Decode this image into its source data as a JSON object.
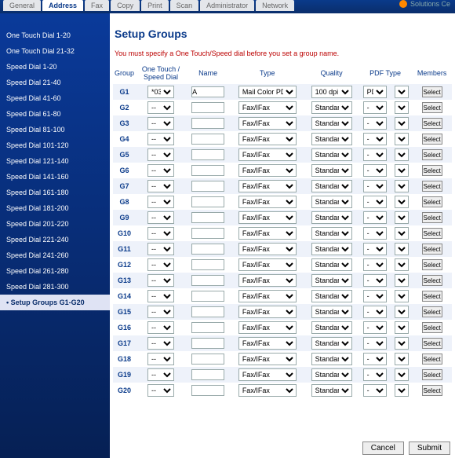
{
  "topTabs": [
    "General",
    "Address",
    "Fax",
    "Copy",
    "Print",
    "Scan",
    "Administrator",
    "Network"
  ],
  "activeTab": 1,
  "brand": "Solutions Ce",
  "sidebar": {
    "items": [
      "One Touch Dial 1-20",
      "One Touch Dial 21-32",
      "Speed Dial 1-20",
      "Speed Dial 21-40",
      "Speed Dial 41-60",
      "Speed Dial 61-80",
      "Speed Dial 81-100",
      "Speed Dial 101-120",
      "Speed Dial 121-140",
      "Speed Dial 141-160",
      "Speed Dial 161-180",
      "Speed Dial 181-200",
      "Speed Dial 201-220",
      "Speed Dial 221-240",
      "Speed Dial 241-260",
      "Speed Dial 261-280",
      "Speed Dial 281-300",
      "Setup Groups G1-G20"
    ],
    "activeIndex": 17
  },
  "page": {
    "title": "Setup Groups",
    "hint": "You must specify a One Touch/Speed dial before you set a group name."
  },
  "headers": {
    "group": "Group",
    "oneTouch": "One Touch /\nSpeed Dial",
    "name": "Name",
    "type": "Type",
    "quality": "Quality",
    "pdfType": "PDF Type",
    "members": "Members"
  },
  "labels": {
    "select": "Select",
    "cancel": "Cancel",
    "submit": "Submit"
  },
  "rows": [
    {
      "g": "G1",
      "ot": "*03",
      "name": "A",
      "type": "Mail Color PDF",
      "quality": "100 dpi",
      "pdft": "PDF",
      "pdft2": "-"
    },
    {
      "g": "G2",
      "ot": "--",
      "name": "",
      "type": "Fax/IFax",
      "quality": "Standard",
      "pdft": "-",
      "pdft2": "-"
    },
    {
      "g": "G3",
      "ot": "--",
      "name": "",
      "type": "Fax/IFax",
      "quality": "Standard",
      "pdft": "-",
      "pdft2": "-"
    },
    {
      "g": "G4",
      "ot": "--",
      "name": "",
      "type": "Fax/IFax",
      "quality": "Standard",
      "pdft": "-",
      "pdft2": "-"
    },
    {
      "g": "G5",
      "ot": "--",
      "name": "",
      "type": "Fax/IFax",
      "quality": "Standard",
      "pdft": "-",
      "pdft2": "-"
    },
    {
      "g": "G6",
      "ot": "--",
      "name": "",
      "type": "Fax/IFax",
      "quality": "Standard",
      "pdft": "-",
      "pdft2": "-"
    },
    {
      "g": "G7",
      "ot": "--",
      "name": "",
      "type": "Fax/IFax",
      "quality": "Standard",
      "pdft": "-",
      "pdft2": "-"
    },
    {
      "g": "G8",
      "ot": "--",
      "name": "",
      "type": "Fax/IFax",
      "quality": "Standard",
      "pdft": "-",
      "pdft2": "-"
    },
    {
      "g": "G9",
      "ot": "--",
      "name": "",
      "type": "Fax/IFax",
      "quality": "Standard",
      "pdft": "-",
      "pdft2": "-"
    },
    {
      "g": "G10",
      "ot": "--",
      "name": "",
      "type": "Fax/IFax",
      "quality": "Standard",
      "pdft": "-",
      "pdft2": "-"
    },
    {
      "g": "G11",
      "ot": "--",
      "name": "",
      "type": "Fax/IFax",
      "quality": "Standard",
      "pdft": "-",
      "pdft2": "-"
    },
    {
      "g": "G12",
      "ot": "--",
      "name": "",
      "type": "Fax/IFax",
      "quality": "Standard",
      "pdft": "-",
      "pdft2": "-"
    },
    {
      "g": "G13",
      "ot": "--",
      "name": "",
      "type": "Fax/IFax",
      "quality": "Standard",
      "pdft": "-",
      "pdft2": "-"
    },
    {
      "g": "G14",
      "ot": "--",
      "name": "",
      "type": "Fax/IFax",
      "quality": "Standard",
      "pdft": "-",
      "pdft2": "-"
    },
    {
      "g": "G15",
      "ot": "--",
      "name": "",
      "type": "Fax/IFax",
      "quality": "Standard",
      "pdft": "-",
      "pdft2": "-"
    },
    {
      "g": "G16",
      "ot": "--",
      "name": "",
      "type": "Fax/IFax",
      "quality": "Standard",
      "pdft": "-",
      "pdft2": "-"
    },
    {
      "g": "G17",
      "ot": "--",
      "name": "",
      "type": "Fax/IFax",
      "quality": "Standard",
      "pdft": "-",
      "pdft2": "-"
    },
    {
      "g": "G18",
      "ot": "--",
      "name": "",
      "type": "Fax/IFax",
      "quality": "Standard",
      "pdft": "-",
      "pdft2": "-"
    },
    {
      "g": "G19",
      "ot": "--",
      "name": "",
      "type": "Fax/IFax",
      "quality": "Standard",
      "pdft": "-",
      "pdft2": "-"
    },
    {
      "g": "G20",
      "ot": "--",
      "name": "",
      "type": "Fax/IFax",
      "quality": "Standard",
      "pdft": "-",
      "pdft2": "-"
    }
  ]
}
